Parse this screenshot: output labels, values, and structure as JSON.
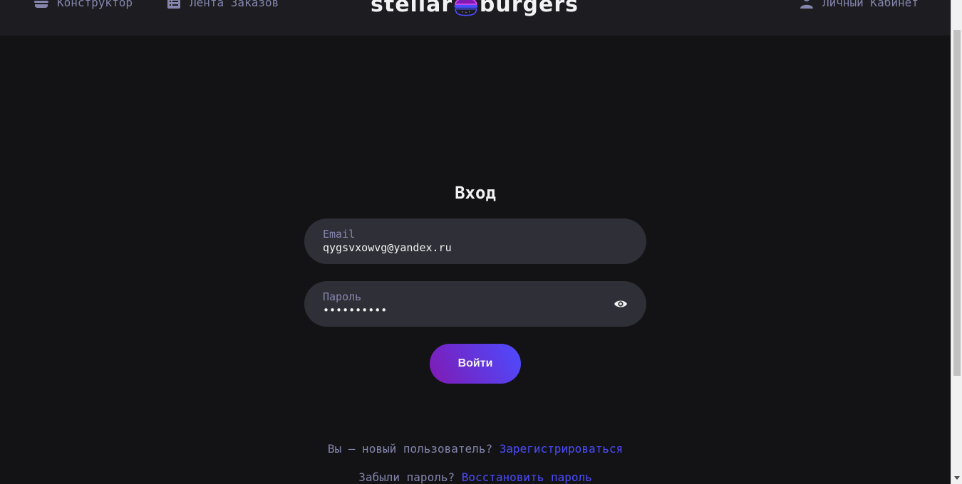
{
  "header": {
    "nav": {
      "constructor_label": "Конструктор",
      "feed_label": "Лента Заказов",
      "account_label": "Личный Кабинет"
    },
    "logo": {
      "left_word": "stellar",
      "right_word": "burgers"
    }
  },
  "login": {
    "title": "Вход",
    "email": {
      "label": "Email",
      "value": "qygsvxowvg@yandex.ru"
    },
    "password": {
      "label": "Пароль",
      "value": "••••••••••"
    },
    "submit_label": "Войти"
  },
  "footer": {
    "register_prompt": "Вы — новый пользователь?",
    "register_link": "Зарегистрироваться",
    "forgot_prompt": "Забыли пароль?",
    "restore_link": "Восстановить пароль"
  },
  "colors": {
    "background": "#131316",
    "header": "#1C1C21",
    "input": "#2F2F37",
    "inactive_text": "#8585AD",
    "accent": "#4C4CFF",
    "button_gradient_start": "#801AB3",
    "button_gradient_end": "#4C4CFF"
  },
  "icons": [
    "burger-icon",
    "list-icon",
    "profile-icon",
    "show-password-icon"
  ]
}
